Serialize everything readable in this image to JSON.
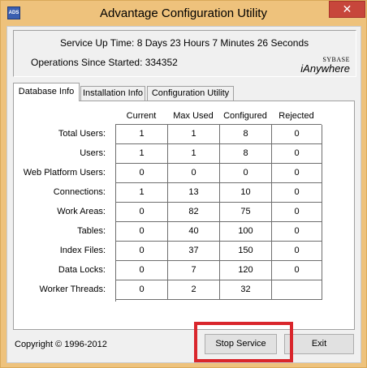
{
  "window": {
    "title": "Advantage Configuration Utility",
    "app_icon_label": "ADS",
    "close_glyph": "✕"
  },
  "status": {
    "uptime": "Service Up Time: 8 Days 23 Hours 7 Minutes 26 Seconds",
    "operations": "Operations Since Started: 334352",
    "brand_top": "SYBASE",
    "brand_main": "iAnywhere"
  },
  "tabs": [
    {
      "label": "Database Info",
      "active": true
    },
    {
      "label": "Installation Info",
      "active": false
    },
    {
      "label": "Configuration Utility",
      "active": false
    }
  ],
  "table": {
    "columns": [
      "Current",
      "Max Used",
      "Configured",
      "Rejected"
    ],
    "rows": [
      {
        "label": "Total Users:",
        "values": [
          "1",
          "1",
          "8",
          "0"
        ]
      },
      {
        "label": "Users:",
        "values": [
          "1",
          "1",
          "8",
          "0"
        ]
      },
      {
        "label": "Web Platform Users:",
        "values": [
          "0",
          "0",
          "0",
          "0"
        ]
      },
      {
        "label": "Connections:",
        "values": [
          "1",
          "13",
          "10",
          "0"
        ]
      },
      {
        "label": "Work Areas:",
        "values": [
          "0",
          "82",
          "75",
          "0"
        ]
      },
      {
        "label": "Tables:",
        "values": [
          "0",
          "40",
          "100",
          "0"
        ]
      },
      {
        "label": "Index Files:",
        "values": [
          "0",
          "37",
          "150",
          "0"
        ]
      },
      {
        "label": "Data Locks:",
        "values": [
          "0",
          "7",
          "120",
          "0"
        ]
      },
      {
        "label": "Worker Threads:",
        "values": [
          "0",
          "2",
          "32",
          ""
        ]
      }
    ]
  },
  "footer": {
    "copyright": "Copyright © 1996-2012",
    "stop_label": "Stop Service",
    "exit_label": "Exit"
  },
  "colors": {
    "title_bar": "#eec27c",
    "close_button": "#c7463b",
    "highlight_box": "#d9262c"
  }
}
